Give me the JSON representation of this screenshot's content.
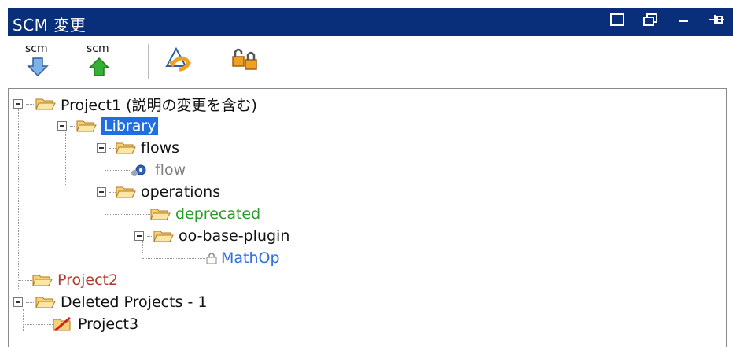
{
  "window": {
    "title": "SCM 変更"
  },
  "toolbar": {
    "update_label": "scm",
    "commit_label": "scm",
    "revert_icon": "revert-icon",
    "unlock_icon": "unlock-icon"
  },
  "tree": {
    "project1": "Project1 (説明の変更を含む)",
    "library": "Library",
    "flows": "flows",
    "flow": "flow",
    "operations": "operations",
    "deprecated": "deprecated",
    "oo_base_plugin": "oo-base-plugin",
    "mathop": "MathOp",
    "project2": "Project2",
    "deleted_projects": "Deleted Projects - 1",
    "project3": "Project3"
  },
  "colors": {
    "title_bg": "#0a2f7a",
    "selection": "#1f6fe0",
    "added": "#2a9d2a",
    "modified": "#2f6de0",
    "project2": "#b03a2e"
  }
}
